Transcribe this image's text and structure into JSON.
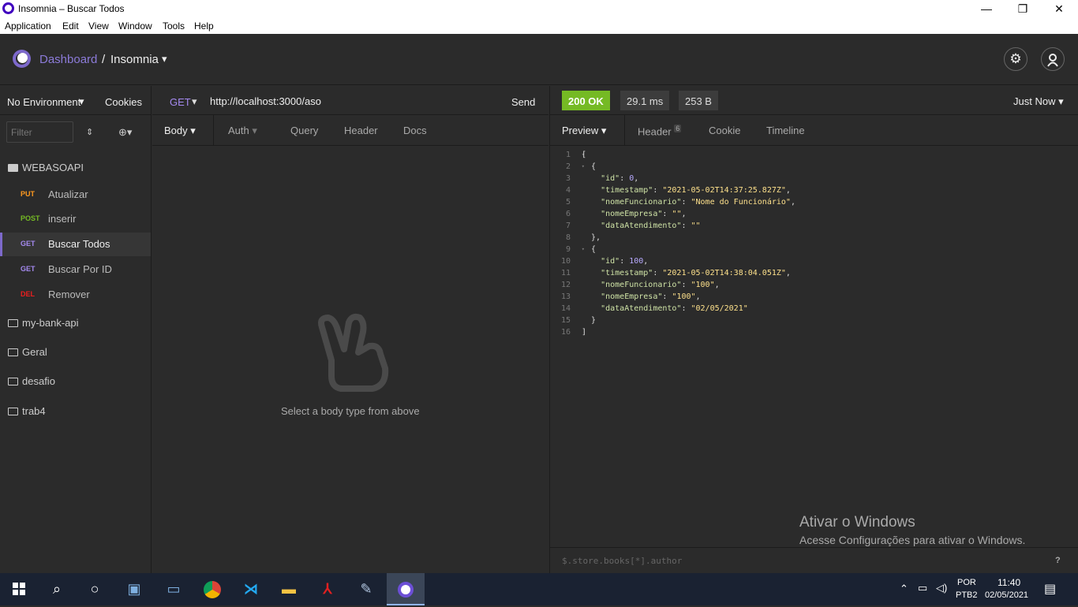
{
  "window": {
    "title": "Insomnia – Buscar Todos",
    "minimize": "—",
    "maximize": "❐",
    "close": "✕"
  },
  "menu": [
    "Application",
    "Edit",
    "View",
    "Window",
    "Tools",
    "Help"
  ],
  "header": {
    "dashboard": "Dashboard",
    "separator": "/",
    "project": "Insomnia",
    "caret": "▾",
    "settings_icon": "⚙",
    "account_icon": "◯"
  },
  "sidebar": {
    "environment": "No Environment",
    "env_caret": "▾",
    "cookies": "Cookies",
    "filter_placeholder": "Filter",
    "workspace": "WEBASOAPI",
    "requests": [
      {
        "method": "PUT",
        "label": "Atualizar",
        "color": "#ff9a1f"
      },
      {
        "method": "POST",
        "label": "inserir",
        "color": "#75ba24"
      },
      {
        "method": "GET",
        "label": "Buscar Todos",
        "color": "#a58af0",
        "active": true
      },
      {
        "method": "GET",
        "label": "Buscar Por ID",
        "color": "#a58af0"
      },
      {
        "method": "DEL",
        "label": "Remover",
        "color": "#ec1e1e"
      }
    ],
    "folders": [
      "my-bank-api",
      "Geral",
      "desafio",
      "trab4"
    ]
  },
  "request": {
    "method": "GET",
    "method_caret": "▾",
    "url": "http://localhost:3000/aso",
    "send": "Send",
    "tabs": {
      "body": "Body",
      "auth": "Auth",
      "query": "Query",
      "header": "Header",
      "docs": "Docs"
    },
    "empty_text": "Select a body type from above"
  },
  "response": {
    "status": "200 OK",
    "time": "29.1 ms",
    "size": "253 B",
    "history": "Just Now",
    "tabs": {
      "preview": "Preview",
      "header": "Header",
      "header_count": "6",
      "cookie": "Cookie",
      "timeline": "Timeline"
    },
    "filter_placeholder": "$.store.books[*].author",
    "help": "?",
    "lines": [
      "[",
      "  {",
      "    \"id\": 0,",
      "    \"timestamp\": \"2021-05-02T14:37:25.827Z\",",
      "    \"nomeFuncionario\": \"Nome do Funcionário\",",
      "    \"nomeEmpresa\": \"\",",
      "    \"dataAtendimento\": \"\"",
      "  },",
      "  {",
      "    \"id\": 100,",
      "    \"timestamp\": \"2021-05-02T14:38:04.051Z\",",
      "    \"nomeFuncionario\": \"100\",",
      "    \"nomeEmpresa\": \"100\",",
      "    \"dataAtendimento\": \"02/05/2021\"",
      "  }",
      "]"
    ]
  },
  "watermark": {
    "title": "Ativar o Windows",
    "subtitle": "Acesse Configurações para ativar o Windows."
  },
  "taskbar": {
    "lang": "POR",
    "layout": "PTB2",
    "time": "11:40",
    "date": "02/05/2021"
  },
  "colors": {
    "accent": "#7d69cb",
    "status_ok": "#75ba24"
  }
}
